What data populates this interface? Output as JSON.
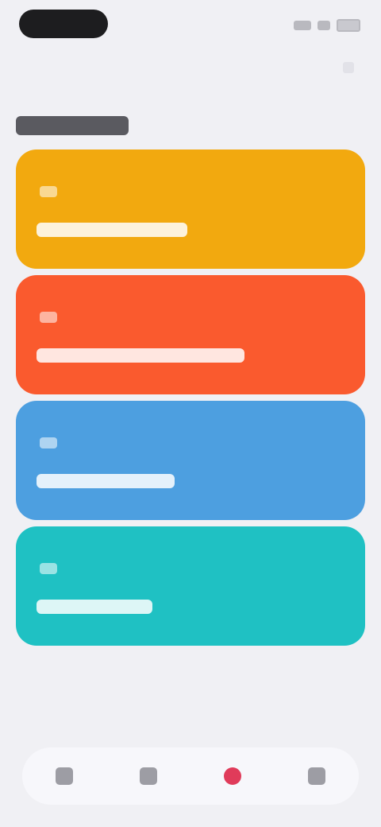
{
  "colors": {
    "background": "#f0f0f4",
    "card_yellow": "#f2a90f",
    "card_orange": "#fa5a2e",
    "card_blue": "#4d9fe0",
    "card_teal": "#1fc1c3",
    "tab_active": "#e03b5a"
  },
  "header": {
    "title": "",
    "action_icon": "add-icon"
  },
  "cards": [
    {
      "color": "#f2a90f",
      "count": "",
      "label": ""
    },
    {
      "color": "#fa5a2e",
      "count": "",
      "label": ""
    },
    {
      "color": "#4d9fe0",
      "count": "",
      "label": ""
    },
    {
      "color": "#1fc1c3",
      "count": "",
      "label": ""
    }
  ],
  "tab_bar": {
    "tabs": [
      {
        "icon": "home-icon",
        "label": ""
      },
      {
        "icon": "list-icon",
        "label": ""
      },
      {
        "icon": "heart-icon",
        "label": "",
        "active": true
      },
      {
        "icon": "profile-icon",
        "label": ""
      }
    ]
  }
}
